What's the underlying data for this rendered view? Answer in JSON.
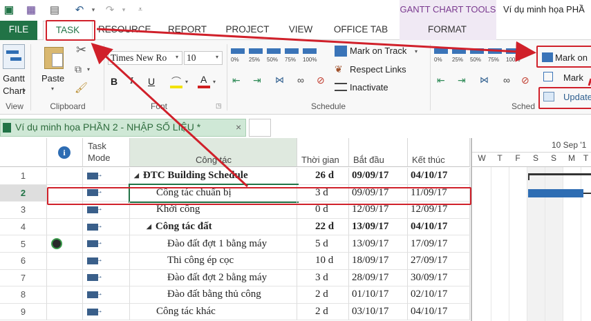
{
  "titlebar": {
    "context_tools": "GANTT CHART TOOLS",
    "document_title": "Ví dụ minh họa PHẦ"
  },
  "tabs": [
    "FILE",
    "TASK",
    "RESOURCE",
    "REPORT",
    "PROJECT",
    "VIEW",
    "OFFICE TAB",
    "FORMAT"
  ],
  "ribbon": {
    "view_group": {
      "button_line1": "Gantt",
      "button_line2": "Chart",
      "label": "View"
    },
    "clipboard_group": {
      "paste_label": "Paste",
      "label": "Clipboard"
    },
    "font_group": {
      "font_name": "Times New Ro",
      "font_size": "10",
      "bold": "B",
      "italic": "I",
      "underline": "U",
      "label": "Font"
    },
    "schedule_group": {
      "pct_labels": [
        "0%",
        "25%",
        "50%",
        "75%",
        "100%"
      ],
      "mark_on_track": "Mark on Track",
      "respect_links": "Respect Links",
      "inactivate": "Inactivate",
      "label": "Schedule"
    },
    "right_group": {
      "pct_labels": [
        "0%",
        "25%",
        "50%",
        "75%",
        "100%"
      ],
      "mark_on_track": "Mark on",
      "mark": "Mark",
      "update": "Update",
      "label": "Sched"
    }
  },
  "document_tab": {
    "label": "Ví dụ minh họa PHẦN 2 - NHẬP SỐ LIỆU *",
    "close": "×"
  },
  "grid": {
    "headers": {
      "info": "i",
      "mode_line1": "Task",
      "mode_line2": "Mode",
      "name": "Công tác",
      "duration": "Thời gian",
      "start": "Bắt đầu",
      "finish": "Kết thúc"
    },
    "rows": [
      {
        "id": "1",
        "name": "ĐTC Building Schedule",
        "duration": "26 d",
        "start": "09/09/17",
        "finish": "04/10/17",
        "summary": true,
        "level": 0
      },
      {
        "id": "2",
        "name": "Công tác chuẩn bị",
        "duration": "3 d",
        "start": "09/09/17",
        "finish": "11/09/17",
        "summary": false,
        "level": 1,
        "selected": true
      },
      {
        "id": "3",
        "name": "Khởi công",
        "duration": "0 d",
        "start": "12/09/17",
        "finish": "12/09/17",
        "summary": false,
        "level": 1
      },
      {
        "id": "4",
        "name": "Công tác đất",
        "duration": "22 d",
        "start": "13/09/17",
        "finish": "04/10/17",
        "summary": true,
        "level": 1
      },
      {
        "id": "5",
        "name": "Đào đất đợt 1 bằng máy",
        "duration": "5 d",
        "start": "13/09/17",
        "finish": "17/09/17",
        "summary": false,
        "level": 2,
        "info_icon": true
      },
      {
        "id": "6",
        "name": "Thi công ép cọc",
        "duration": "10 d",
        "start": "18/09/17",
        "finish": "27/09/17",
        "summary": false,
        "level": 2
      },
      {
        "id": "7",
        "name": "Đào đất đợt 2 bằng máy",
        "duration": "3 d",
        "start": "28/09/17",
        "finish": "30/09/17",
        "summary": false,
        "level": 2
      },
      {
        "id": "8",
        "name": "Đào đất bằng thủ công",
        "duration": "2 d",
        "start": "01/10/17",
        "finish": "02/10/17",
        "summary": false,
        "level": 2
      },
      {
        "id": "9",
        "name": "Công tác khác",
        "duration": "2 d",
        "start": "03/10/17",
        "finish": "04/10/17",
        "summary": false,
        "level": 1
      }
    ]
  },
  "gantt": {
    "week_label": "10 Sep '1",
    "days": [
      "W",
      "T",
      "F",
      "S",
      "S",
      "M",
      "T"
    ]
  },
  "colors": {
    "accent": "#217346",
    "highlight": "#d0202a",
    "bar": "#2e6db3"
  }
}
